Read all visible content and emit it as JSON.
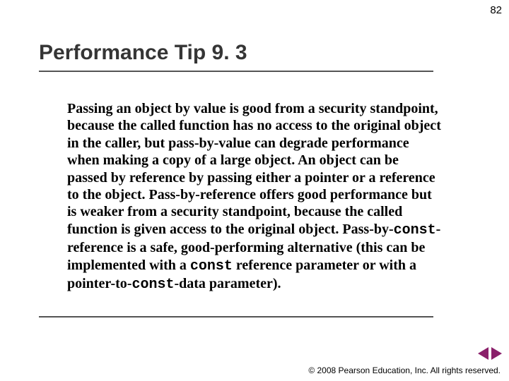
{
  "page_number": "82",
  "title": "Performance Tip 9. 3",
  "body": {
    "seg1": "Passing an object by value is good from a security standpoint, because the called function has no access to the original object in the caller, but pass-by-value can degrade performance when making a copy of a large object. An object can be passed by reference by passing either a pointer or a reference to the object. Pass-by-reference offers good performance but is weaker from a security standpoint, because the called function is given access to the original object. Pass-by-",
    "const1": "const",
    "seg2": "-reference is a safe, good-performing alternative (this can be implemented with a ",
    "const2": "const",
    "seg3": " reference parameter or with a pointer-to-",
    "const3": "const",
    "seg4": "-data parameter)."
  },
  "footer": {
    "copyright_symbol": "©",
    "text1": " 2008 Pearson Education, Inc.  ",
    "text2": "All rights reserved."
  },
  "nav": {
    "prev_label": "previous-slide",
    "next_label": "next-slide"
  }
}
